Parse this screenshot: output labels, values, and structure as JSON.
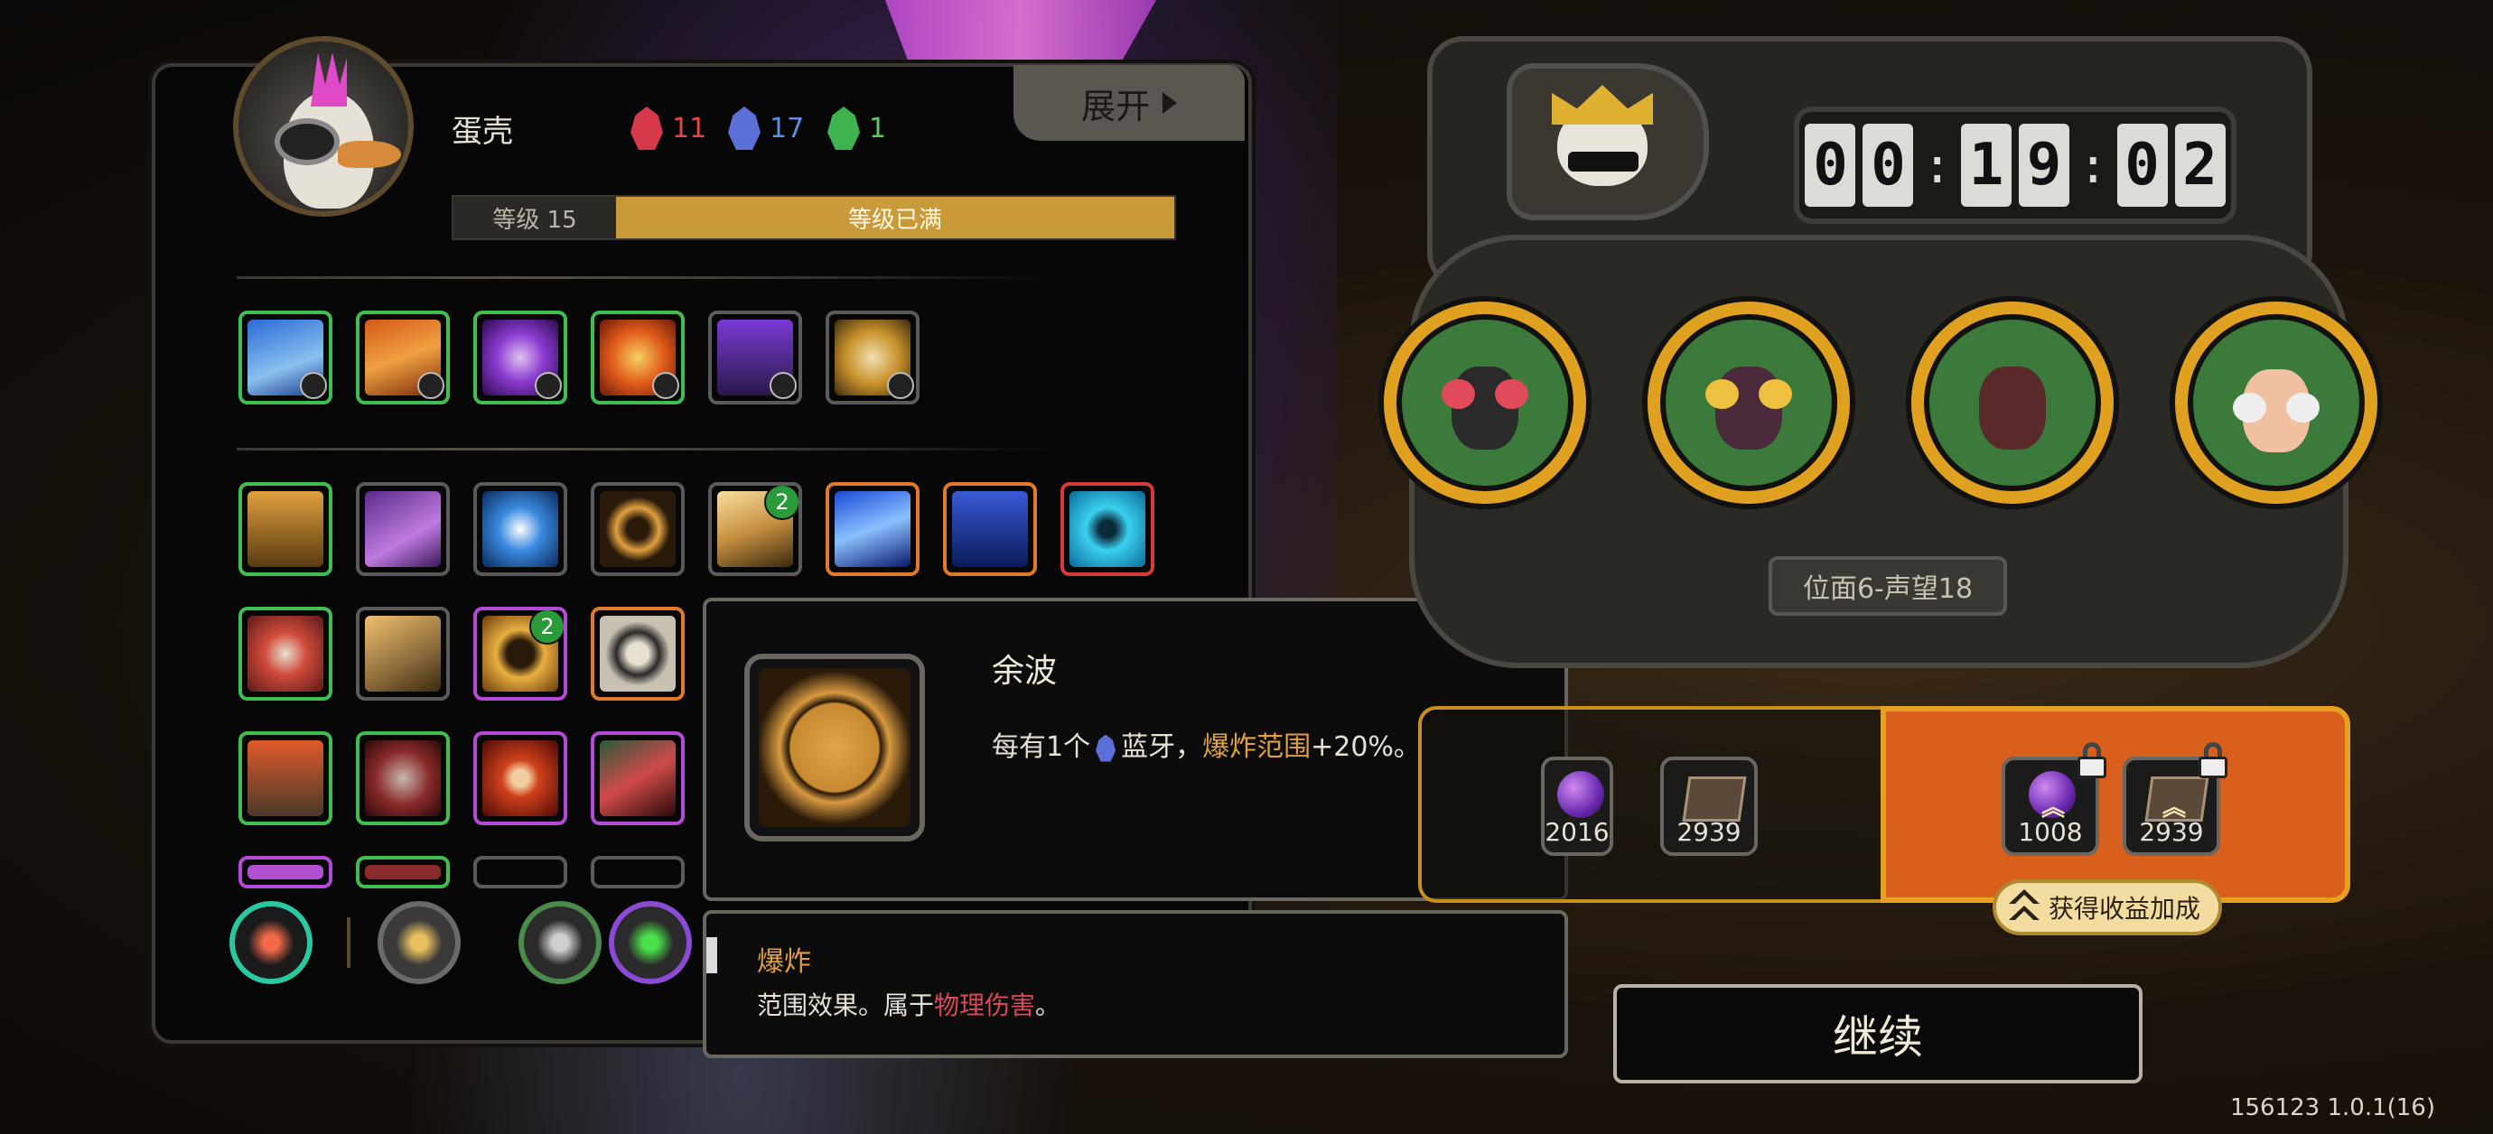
{
  "character": {
    "name": "蛋壳",
    "units": [
      {
        "color": "red",
        "count": "11"
      },
      {
        "color": "blue",
        "count": "17"
      },
      {
        "color": "green",
        "count": "1"
      }
    ],
    "expand_label": "展开",
    "level_label": "等级 15",
    "level_status": "等级已满"
  },
  "skills": {
    "row1": [
      {
        "icon": "blue-waterfall-skill-icon",
        "border": "green"
      },
      {
        "icon": "orange-flame-claw-skill-icon",
        "border": "green"
      },
      {
        "icon": "purple-spirit-skill-icon",
        "border": "green"
      },
      {
        "icon": "fire-beast-skill-icon",
        "border": "green"
      },
      {
        "icon": "purple-lantern-skill-icon",
        "border": "gray"
      },
      {
        "icon": "gold-shield-skill-icon",
        "border": "gray"
      }
    ],
    "badges": [
      "2",
      "2"
    ]
  },
  "tooltip": {
    "title": "余波",
    "desc_prefix": "每有1个",
    "desc_unit": "蓝牙，",
    "desc_highlight": "爆炸范围",
    "desc_suffix": "+20%。"
  },
  "tooltip2": {
    "title": "爆炸",
    "desc_prefix": "范围效果。属于",
    "desc_highlight": "物理伤害",
    "desc_suffix": "。"
  },
  "timer": {
    "d1": "0",
    "d2": "0",
    "d3": "1",
    "d4": "9",
    "d5": "0",
    "d6": "2"
  },
  "stage": "位面6-声望18",
  "rewards": {
    "left": [
      {
        "type": "orb",
        "value": "2016"
      },
      {
        "type": "book",
        "value": "2939"
      }
    ],
    "right": [
      {
        "type": "orb",
        "value": "1008"
      },
      {
        "type": "book",
        "value": "2939"
      }
    ],
    "bonus_label": "获得收益加成"
  },
  "continue_label": "继续",
  "version": "156123 1.0.1(16)"
}
